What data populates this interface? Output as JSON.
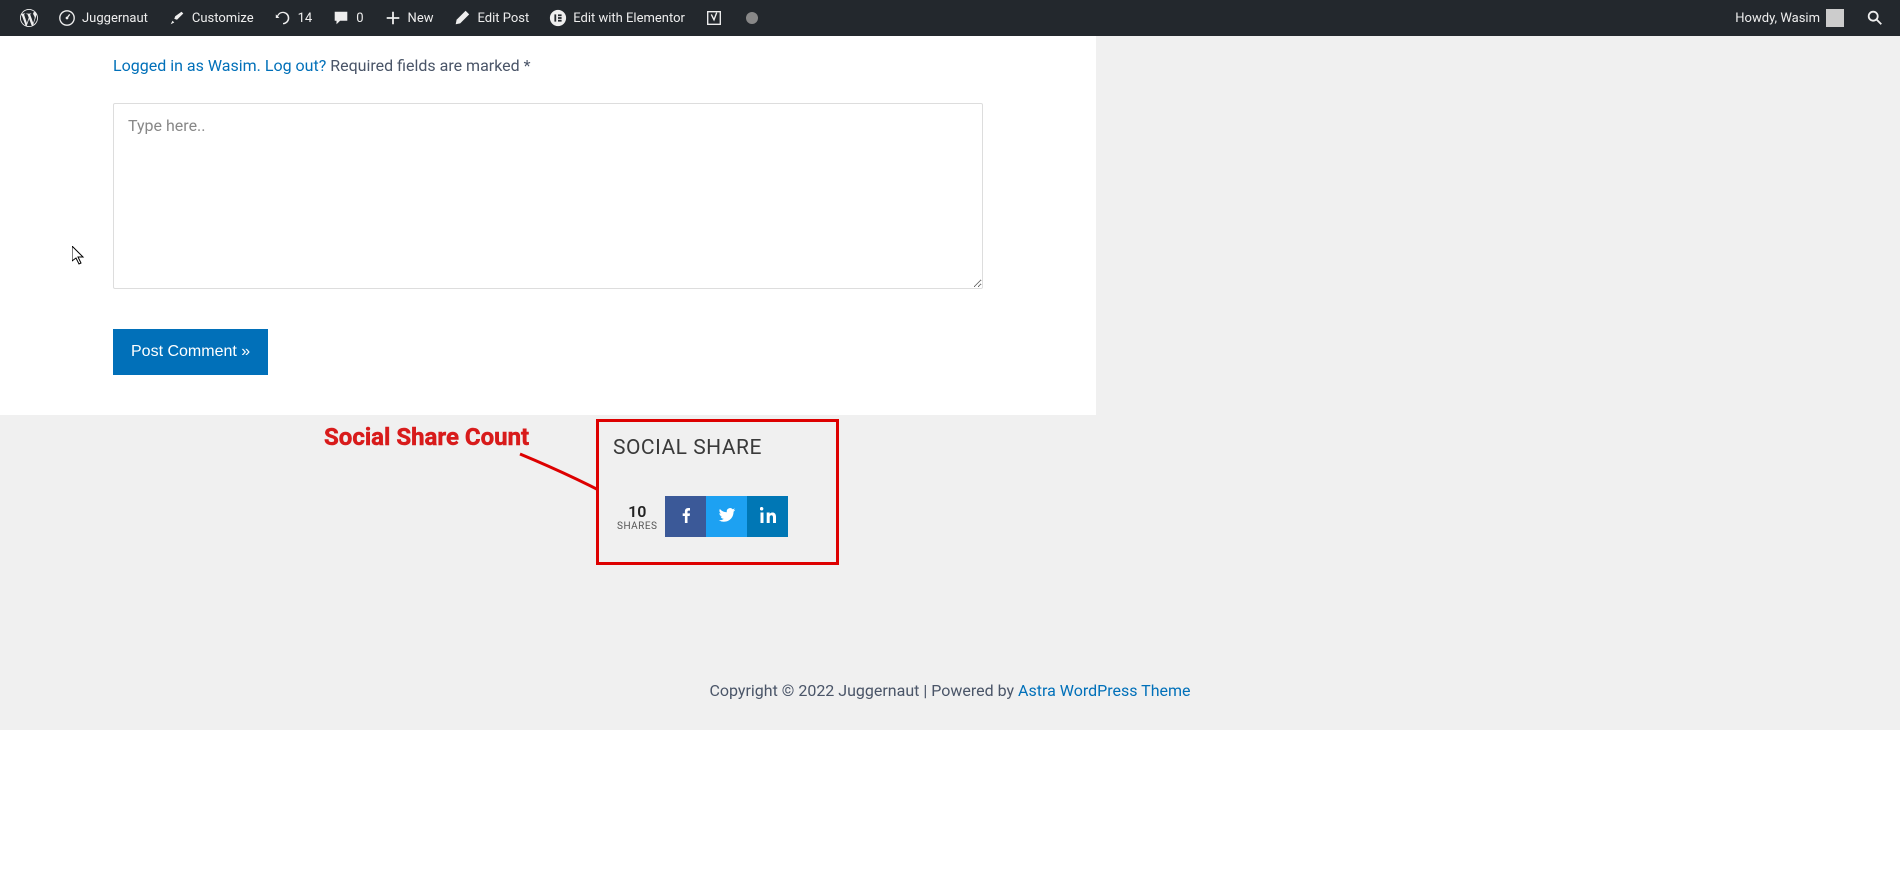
{
  "adminbar": {
    "site_name": "Juggernaut",
    "customize": "Customize",
    "updates_count": "14",
    "comments_count": "0",
    "new": "New",
    "edit_post": "Edit Post",
    "edit_elementor": "Edit with Elementor",
    "howdy": "Howdy, Wasim"
  },
  "comment": {
    "logged_in_prefix": "Logged in as Wasim",
    "logout": "Log out?",
    "required": "Required fields are marked *",
    "placeholder": "Type here..",
    "submit": "Post Comment »"
  },
  "annotation": {
    "label": "Social Share Count"
  },
  "social": {
    "title": "SOCIAL SHARE",
    "count": "10",
    "shares_label": "SHARES"
  },
  "footer": {
    "copyright": "Copyright © 2022 Juggernaut | Powered by ",
    "theme_link": "Astra WordPress Theme"
  }
}
